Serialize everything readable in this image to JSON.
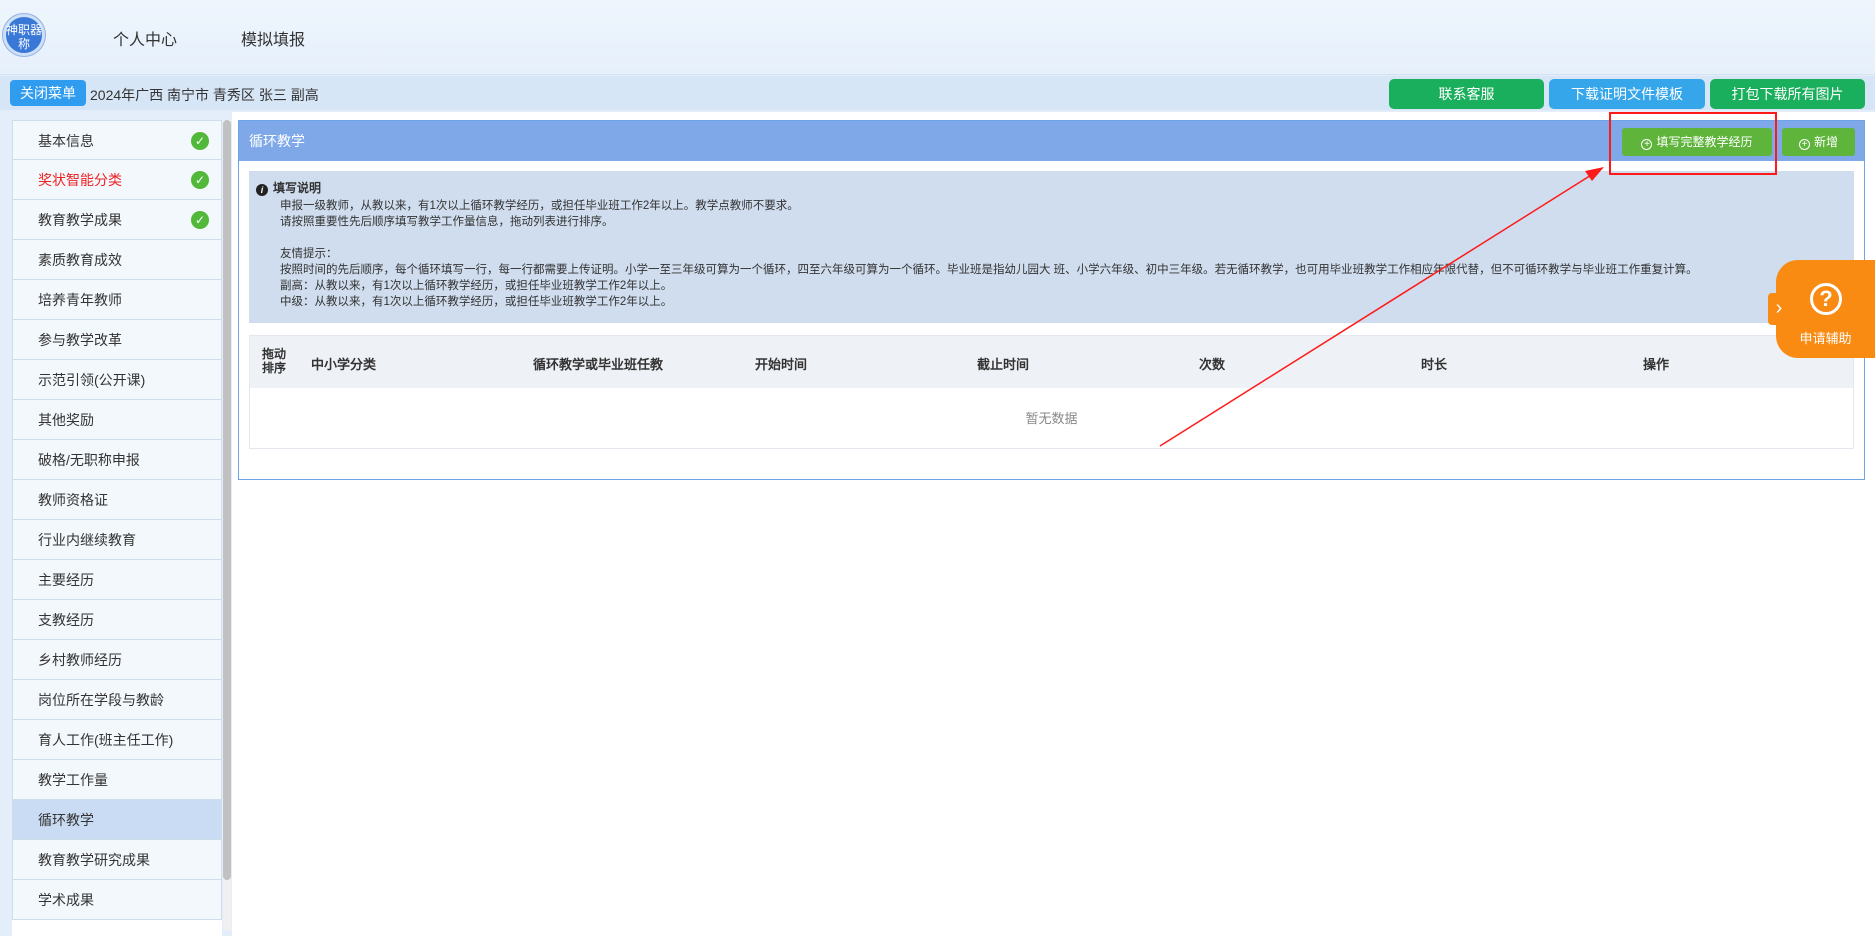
{
  "header": {
    "logo_text": "神职器称",
    "nav": [
      "个人中心",
      "模拟填报"
    ]
  },
  "subbar": {
    "close_menu": "关闭菜单",
    "breadcrumb": "2024年广西 南宁市 青秀区 张三 副高",
    "buttons": [
      "联系客服",
      "下载证明文件模板",
      "打包下载所有图片"
    ],
    "colors": {
      "service": "#1aaf5d",
      "template": "#35a6ea",
      "pack": "#1aaf5d"
    }
  },
  "sidebar": {
    "items": [
      {
        "label": "基本信息",
        "checked": true
      },
      {
        "label": "奖状智能分类",
        "checked": true,
        "red": true
      },
      {
        "label": "教育教学成果",
        "checked": true
      },
      {
        "label": "素质教育成效"
      },
      {
        "label": "培养青年教师"
      },
      {
        "label": "参与教学改革"
      },
      {
        "label": "示范引领(公开课)"
      },
      {
        "label": "其他奖励"
      },
      {
        "label": "破格/无职称申报"
      },
      {
        "label": "教师资格证"
      },
      {
        "label": "行业内继续教育"
      },
      {
        "label": "主要经历"
      },
      {
        "label": "支教经历"
      },
      {
        "label": "乡村教师经历"
      },
      {
        "label": "岗位所在学段与教龄"
      },
      {
        "label": "育人工作(班主任工作)"
      },
      {
        "label": "教学工作量"
      },
      {
        "label": "循环教学",
        "active": true
      },
      {
        "label": "教育教学研究成果"
      },
      {
        "label": "学术成果"
      }
    ]
  },
  "panel": {
    "title": "循环教学",
    "fill_button": "填写完整教学经历",
    "add_button": "新增",
    "notice": {
      "title": "填写说明",
      "lines1": [
        "申报一级教师，从教以来，有1次以上循环教学经历，或担任毕业班工作2年以上。教学点教师不要求。",
        "请按照重要性先后顺序填写教学工作量信息，拖动列表进行排序。"
      ],
      "lines2": [
        "友情提示：",
        "按照时间的先后顺序，每个循环填写一行，每一行都需要上传证明。小学一至三年级可算为一个循环，四至六年级可算为一个循环。毕业班是指幼儿园大 班、小学六年级、初中三年级。若无循环教学，也可用毕业班教学工作相应年限代替，但不可循环教学与毕业班工作重复计算。",
        "副高：从教以来，有1次以上循环教学经历，或担任毕业班教学工作2年以上。",
        "中级：从教以来，有1次以上循环教学经历，或担任毕业班教学工作2年以上。"
      ]
    },
    "table": {
      "columns": [
        "拖动排序",
        "中小学分类",
        "循环教学或毕业班任教",
        "开始时间",
        "截止时间",
        "次数",
        "时长",
        "操作"
      ],
      "drag_col": [
        "拖动",
        "排序"
      ],
      "empty": "暂无数据"
    }
  },
  "help": {
    "label": "申请辅助",
    "color": "#f98a12"
  }
}
